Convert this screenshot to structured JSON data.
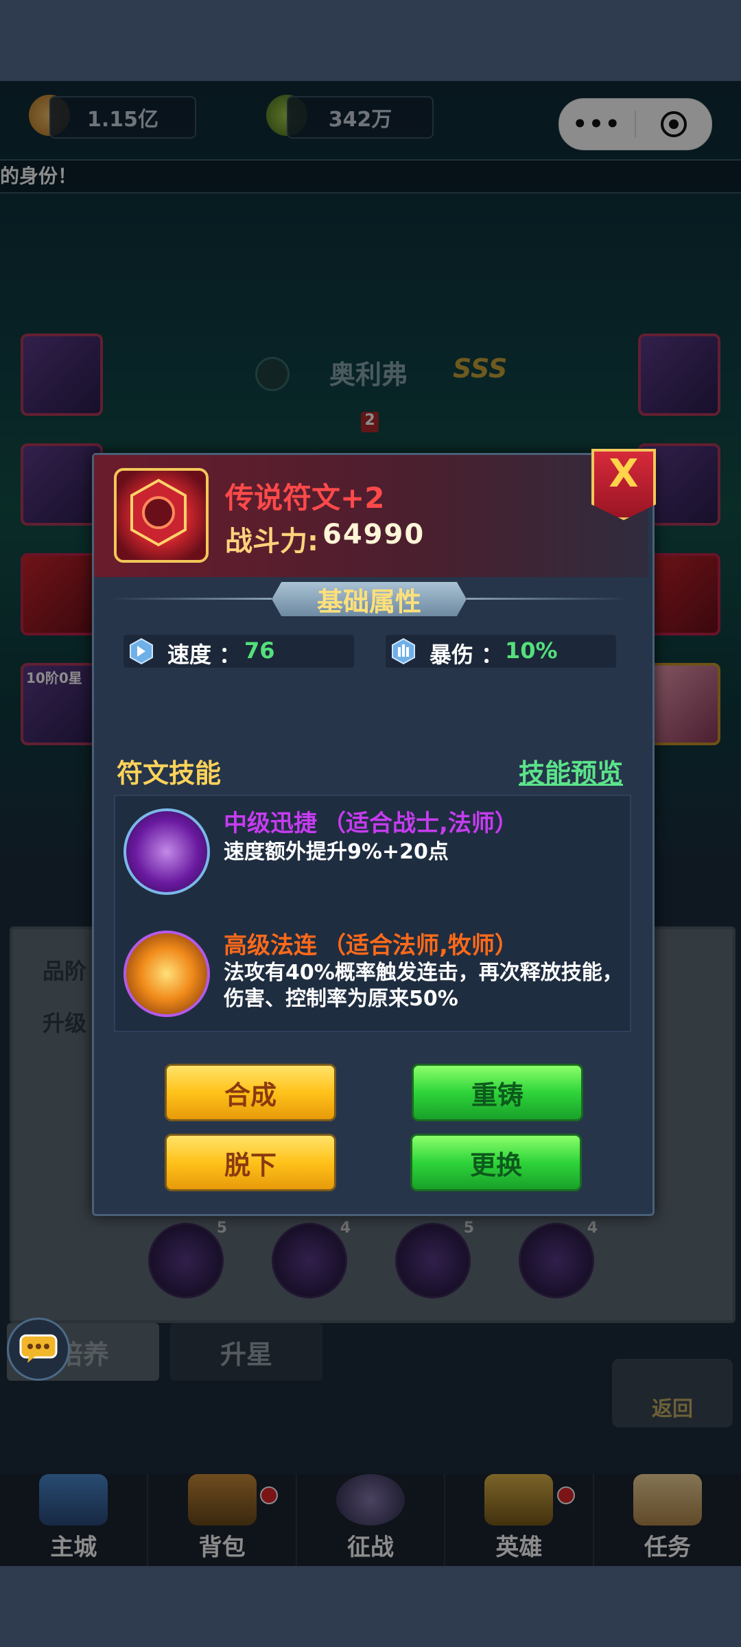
{
  "header": {
    "gold": "1.15亿",
    "gems": "342万",
    "marquee": "的身份！"
  },
  "hero": {
    "name": "奥利弗",
    "grade": "SSS",
    "level": "2",
    "star_badge": "10阶0星"
  },
  "popup": {
    "rune_title": "传说符文+2",
    "power_label": "战斗力:",
    "power_value": "64990",
    "close_label": "X",
    "section_title": "基础属性",
    "stats": [
      {
        "label": "速度 ：",
        "value": "76"
      },
      {
        "label": "暴伤 ：",
        "value": "10%"
      }
    ],
    "skills_heading": "符文技能",
    "skills_preview": "技能预览",
    "skills": [
      {
        "name": "中级迅捷",
        "fit": "（适合战士,法师）",
        "desc1": "速度额外提升9%+20点",
        "desc2": ""
      },
      {
        "name": "高级法连",
        "fit": "（适合法师,牧师）",
        "desc1": "法攻有40%概率触发连击，再次释放技能，",
        "desc2": "伤害、控制率为原来50%"
      }
    ],
    "buttons": {
      "combine": "合成",
      "recast": "重铸",
      "remove": "脱下",
      "replace": "更换"
    }
  },
  "background_ui": {
    "row1_label": "品阶",
    "row2_label": "升级",
    "tab_train": "培养",
    "tab_star": "升星",
    "back": "返回",
    "orb_counts": [
      "5",
      "4",
      "5",
      "4"
    ]
  },
  "nav": {
    "items": [
      "主城",
      "背包",
      "征战",
      "英雄",
      "任务"
    ]
  },
  "colors": {
    "title_red": "#ff4a4a",
    "stat_green": "#54e07c",
    "skill1_purple": "#c63cf0",
    "skill2_orange": "#ff6a1a",
    "heading_yellow": "#ffd35a"
  }
}
